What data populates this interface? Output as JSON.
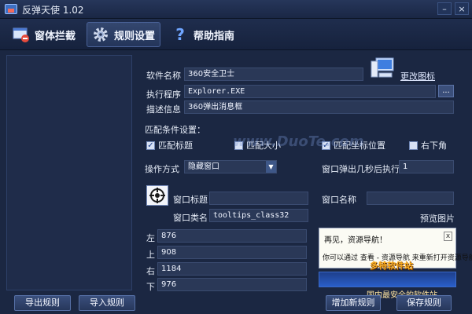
{
  "titlebar": {
    "title": "反弹天使 1.02",
    "minimize": "–",
    "close": "×"
  },
  "toolbar": {
    "tabs": [
      {
        "label": "窗体拦截",
        "icon": "window-block-icon"
      },
      {
        "label": "规则设置",
        "icon": "gear-icon"
      },
      {
        "label": "帮助指南",
        "icon": "help-icon"
      }
    ]
  },
  "rule": {
    "software_name_label": "软件名称",
    "software_name": "360安全卫士",
    "change_icon_link": "更改图标",
    "exec_label": "执行程序",
    "exec_value": "Explorer.EXE",
    "browse_label": "...",
    "desc_label": "描述信息",
    "desc_value": "360弹出消息框"
  },
  "match": {
    "section_label": "匹配条件设置：",
    "match_title": "匹配标题",
    "match_size": "匹配大小",
    "match_position": "匹配坐标位置",
    "bottom_right": "右下角",
    "action_label": "操作方式",
    "action_value": "隐藏窗口",
    "delay_label": "窗口弹出几秒后执行",
    "delay_value": "1",
    "window_title_label": "窗口标题",
    "window_title_value": "",
    "window_name_label": "窗口名称",
    "window_name_value": "",
    "window_class_label": "窗口类名",
    "window_class_value": "tooltips_class32",
    "preview_label": "预览图片"
  },
  "coords": [
    {
      "label": "左",
      "value": "876"
    },
    {
      "label": "上",
      "value": "908"
    },
    {
      "label": "右",
      "value": "1184"
    },
    {
      "label": "下",
      "value": "976"
    }
  ],
  "preview": {
    "line1": "再见，资源导航！",
    "line2": "你可以通过 查看 - 资源导航 来重新打开资源导航)",
    "close": "x"
  },
  "watermarks": {
    "main": "www.DuoTe.com",
    "corner": "多特软件站",
    "bottom": "国内最安全的软件站"
  },
  "buttons": {
    "export": "导出规则",
    "import": "导入规则",
    "add": "增加新规则",
    "save": "保存规则"
  }
}
